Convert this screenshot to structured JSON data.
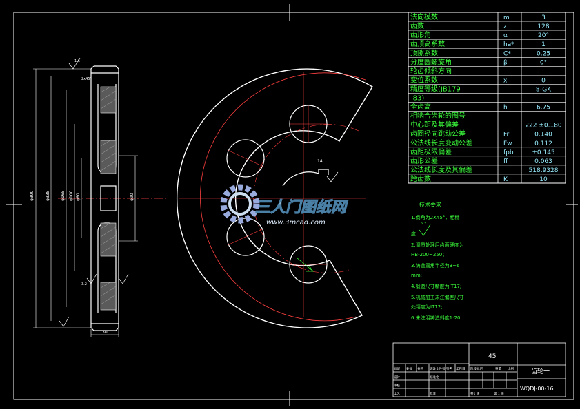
{
  "params": [
    {
      "name": "法向模数",
      "sym": "m",
      "val": "3"
    },
    {
      "name": "齿数",
      "sym": "z",
      "val": "128"
    },
    {
      "name": "齿形角",
      "sym": "α",
      "val": "20°"
    },
    {
      "name": "齿顶高系数",
      "sym": "ha*",
      "val": "1"
    },
    {
      "name": "顶隙系数",
      "sym": "C*",
      "val": "0.25"
    },
    {
      "name": "分度圆螺旋角",
      "sym": "β",
      "val": "0°"
    },
    {
      "name": "轮齿倾斜方向",
      "sym": "",
      "val": ""
    },
    {
      "name": "变位系数",
      "sym": "x",
      "val": "0"
    },
    {
      "name": "精度等级(JB179",
      "sym": "",
      "val": "8-GK"
    },
    {
      "name": "-83)",
      "sym": "",
      "val": ""
    },
    {
      "name": "全齿高",
      "sym": "h",
      "val": "6.75"
    },
    {
      "name": "相啮合齿轮的图号",
      "sym": "",
      "val": ""
    },
    {
      "name": "中心距及其偏差",
      "sym": "",
      "val": "222 ±0.180"
    },
    {
      "name": "齿圈径向跳动公差",
      "sym": "Fr",
      "val": "0.140"
    },
    {
      "name": "公法线长度变动公差",
      "sym": "Fw",
      "val": "0.112"
    },
    {
      "name": "齿距极限偏差",
      "sym": "fpb",
      "val": "±0.145"
    },
    {
      "name": "齿形公差",
      "sym": "ff",
      "val": "0.063"
    },
    {
      "name": "公法线长度及其偏差",
      "sym": "",
      "val": "518.9328"
    },
    {
      "name": "跨齿数",
      "sym": "K",
      "val": "10"
    }
  ],
  "tech": {
    "title": "技术要求",
    "lines": [
      "1.倒角为2X45°，粗糙",
      "度",
      "2.调质处理后齿面硬度为",
      "HB-200~250；",
      "3.铸造圆角半径为3~6",
      "mm;",
      "4.锻造尺寸精度为IT17;",
      "5.机械加工未注偏差尺寸",
      "处精度为IT12;",
      "6.未注明铸造斜度1:20"
    ],
    "roughness": "6.3"
  },
  "title_block": {
    "material": "45",
    "part_name": "齿轮一",
    "drawing_no": "WQDJ-00-16",
    "designer": "设计",
    "standardizer": "标准化",
    "review": "审核",
    "craft": "工艺",
    "approve": "批准",
    "stage_mark": "阶段标记",
    "weight": "重量",
    "ratio": "比例",
    "sheet_total": "共1 张",
    "sheet_no": "第 1 张",
    "rev_headers": [
      "标记",
      "处数",
      "分区",
      "更改文件号",
      "签名",
      "年月日"
    ]
  },
  "dims": {
    "od": "φ390",
    "d2": "φ338",
    "d3": "φ165",
    "d4": "φ100",
    "d5": "φ60",
    "hub": "φ90",
    "width": "30",
    "chamfer": "2x45°",
    "keyway": "14",
    "ra1": "1.6",
    "ra2": "3.2"
  },
  "watermark": {
    "brand": "三人门图纸网",
    "url": "www.3mcad.com"
  }
}
